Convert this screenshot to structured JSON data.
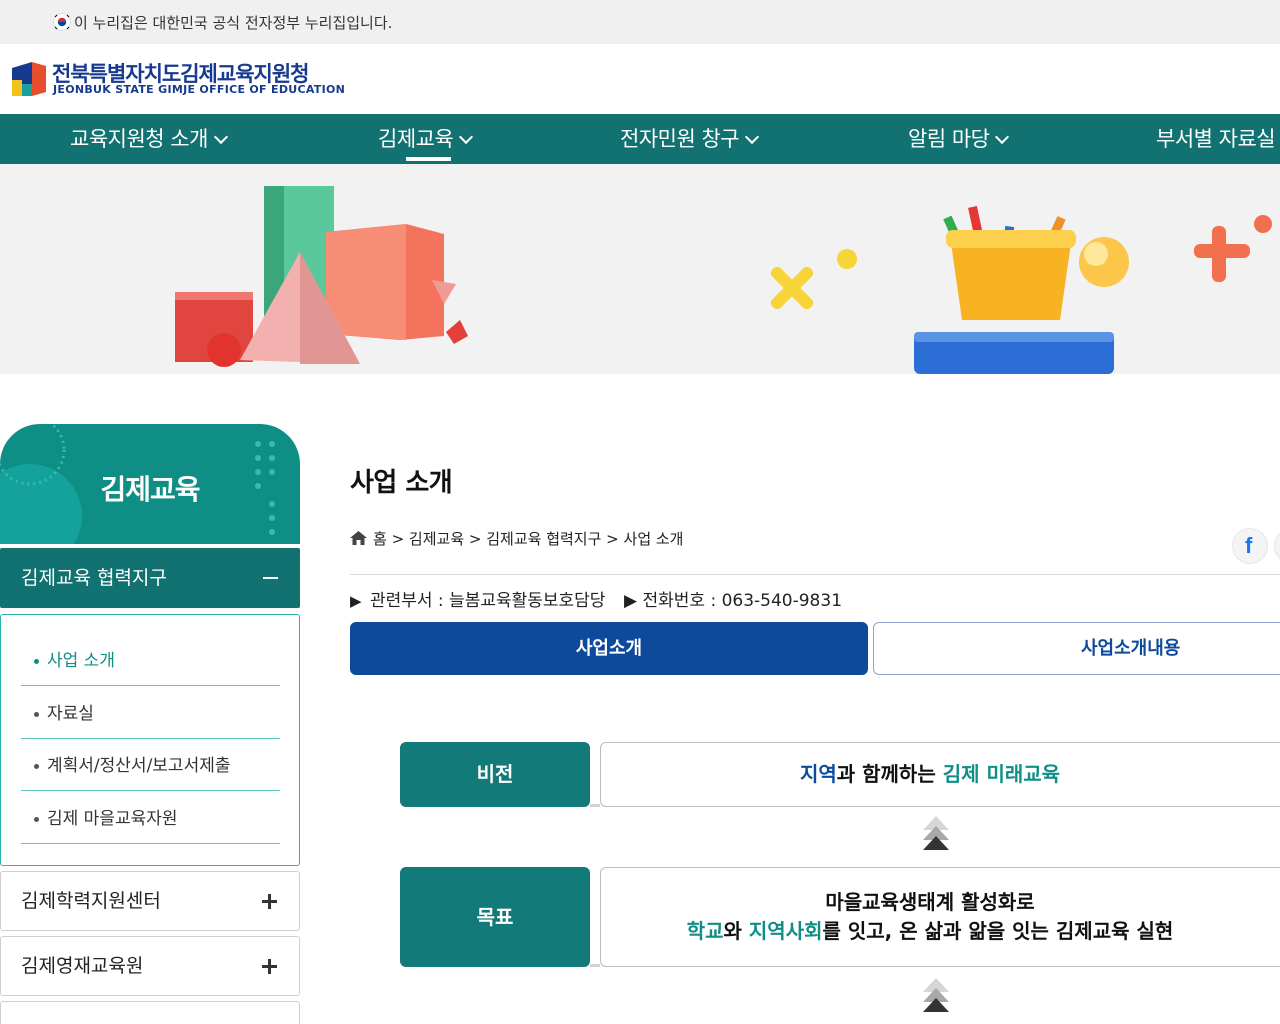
{
  "gov_notice": "이 누리집은 대한민국 공식 전자정부 누리집입니다.",
  "logo": {
    "name_ko": "전북특별자치도김제교육지원청",
    "name_en": "JEONBUK STATE GIMJE OFFICE OF EDUCATION"
  },
  "gnb": [
    {
      "label": "교육지원청 소개"
    },
    {
      "label": "김제교육"
    },
    {
      "label": "전자민원 창구"
    },
    {
      "label": "알림 마당"
    },
    {
      "label": "부서별 자료실"
    }
  ],
  "lnb": {
    "title": "김제교육",
    "section": "김제교육 협력지구",
    "sub_items": [
      "사업 소개",
      "자료실",
      "계획서/정산서/보고서제출",
      "김제 마을교육자원"
    ],
    "groups": [
      "김제학력지원센터",
      "김제영재교육원"
    ]
  },
  "page": {
    "title": "사업 소개",
    "breadcrumb": [
      "홈",
      "김제교육",
      "김제교육 협력지구",
      "사업 소개"
    ],
    "dept_label": "관련부서 : 늘봄교육활동보호담당",
    "phone_label": "전화번호 : 063-540-9831",
    "tabs": [
      "사업소개",
      "사업소개내용"
    ]
  },
  "vision": {
    "label": "비전",
    "parts": [
      "지역",
      "과 함께하는 ",
      "김제 미래교육"
    ]
  },
  "goal": {
    "label": "목표",
    "line1": "마을교육생태계 활성화로",
    "line2_parts": [
      "학교",
      "와 ",
      "지역사회",
      "를 잇고, 온 삶과 앎을 잇는 김제교육 실현"
    ]
  },
  "colors": {
    "teal": "#127272",
    "navy": "#0e4a9c",
    "logo_blue": "#173a8e"
  }
}
